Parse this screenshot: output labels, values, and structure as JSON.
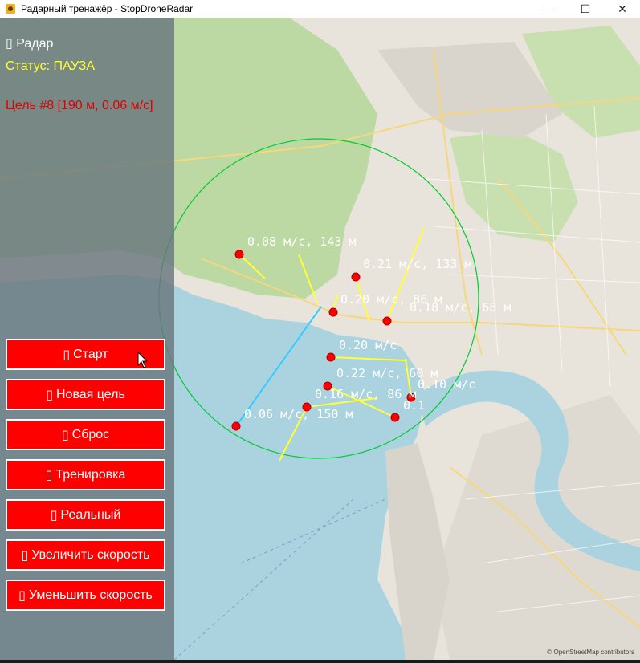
{
  "window": {
    "title": "Радарный тренажёр - StopDroneRadar",
    "minimize_glyph": "—",
    "maximize_glyph": "☐",
    "close_glyph": "✕"
  },
  "panel": {
    "radar_title": "Радар",
    "status": "Статус: ПАУЗА",
    "target_info": "Цель #8 [190 м, 0.06 м/с]"
  },
  "buttons": {
    "start": "Старт",
    "new_target": "Новая цель",
    "reset": "Сброс",
    "training": "Тренировка",
    "real": "Реальный",
    "speed_up": "Увеличить скорость",
    "speed_down": "Уменьшить скорость"
  },
  "glyph_placeholder": "▯",
  "map": {
    "attribution": "© OpenStreetMap contributors",
    "labels": [
      "0.08 м/с, 143 м",
      "0.21 м/с, 133 м",
      "0.20 м/с, 86 м",
      "0.18 м/с, 68 м",
      "0.20 м/с",
      "0.22 м/с, 60 м",
      "0.16 м/с, 86 м",
      "0.10 м/с",
      "0.06 м/с, 150 м",
      "0.1"
    ]
  },
  "colors": {
    "button_bg": "#ff0000",
    "status": "#ffff33",
    "target_info": "#e00000",
    "radar_ring": "#00cc33",
    "heading_line": "#ffff33",
    "selected_line": "#33ccff",
    "target_dot": "#ff0000"
  },
  "icons": {
    "app": "radar-app-icon",
    "cursor": "mouse-pointer-icon"
  }
}
